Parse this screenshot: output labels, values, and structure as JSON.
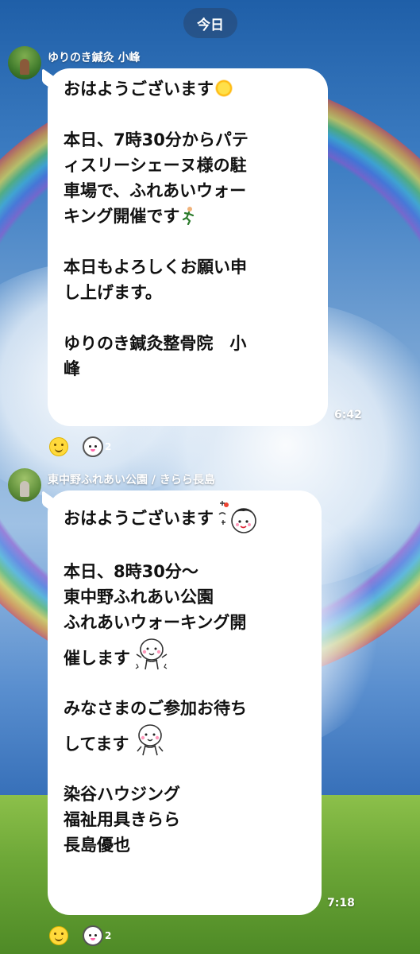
{
  "date_label": "今日",
  "messages": [
    {
      "sender": "ゆりのき鍼灸 小峰",
      "lines": [
        "おはようございます",
        "",
        "本日、7時30分からパテ",
        "ィスリーシェーヌ様の駐",
        "車場で、ふれあいウォー",
        "キング開催です",
        "",
        "本日もよろしくお願い申",
        "し上げます。",
        "",
        "ゆりのき鍼灸整骨院　小",
        "峰"
      ],
      "time": "6:42",
      "reactions": [
        {
          "icon": "smile-reaction-icon"
        },
        {
          "icon": "sticker-reaction-icon",
          "count": "2"
        }
      ]
    },
    {
      "sender": "東中野ふれあい公園 / きらら長島",
      "lines": [
        "おはようございます",
        "",
        "本日、8時30分〜",
        "東中野ふれあい公園",
        "ふれあいウォーキング開",
        "催します",
        "",
        "みなさまのご参加お待ち",
        "してます",
        "",
        "染谷ハウジング",
        "福祉用具きらら",
        "長島優也"
      ],
      "time": "7:18",
      "reactions": [
        {
          "icon": "smile-reaction-icon"
        },
        {
          "icon": "sticker-reaction-icon",
          "count": "2"
        }
      ]
    }
  ],
  "colors": {
    "bubble": "#ffffff",
    "text": "#111111",
    "date_chip": "#28466e"
  }
}
